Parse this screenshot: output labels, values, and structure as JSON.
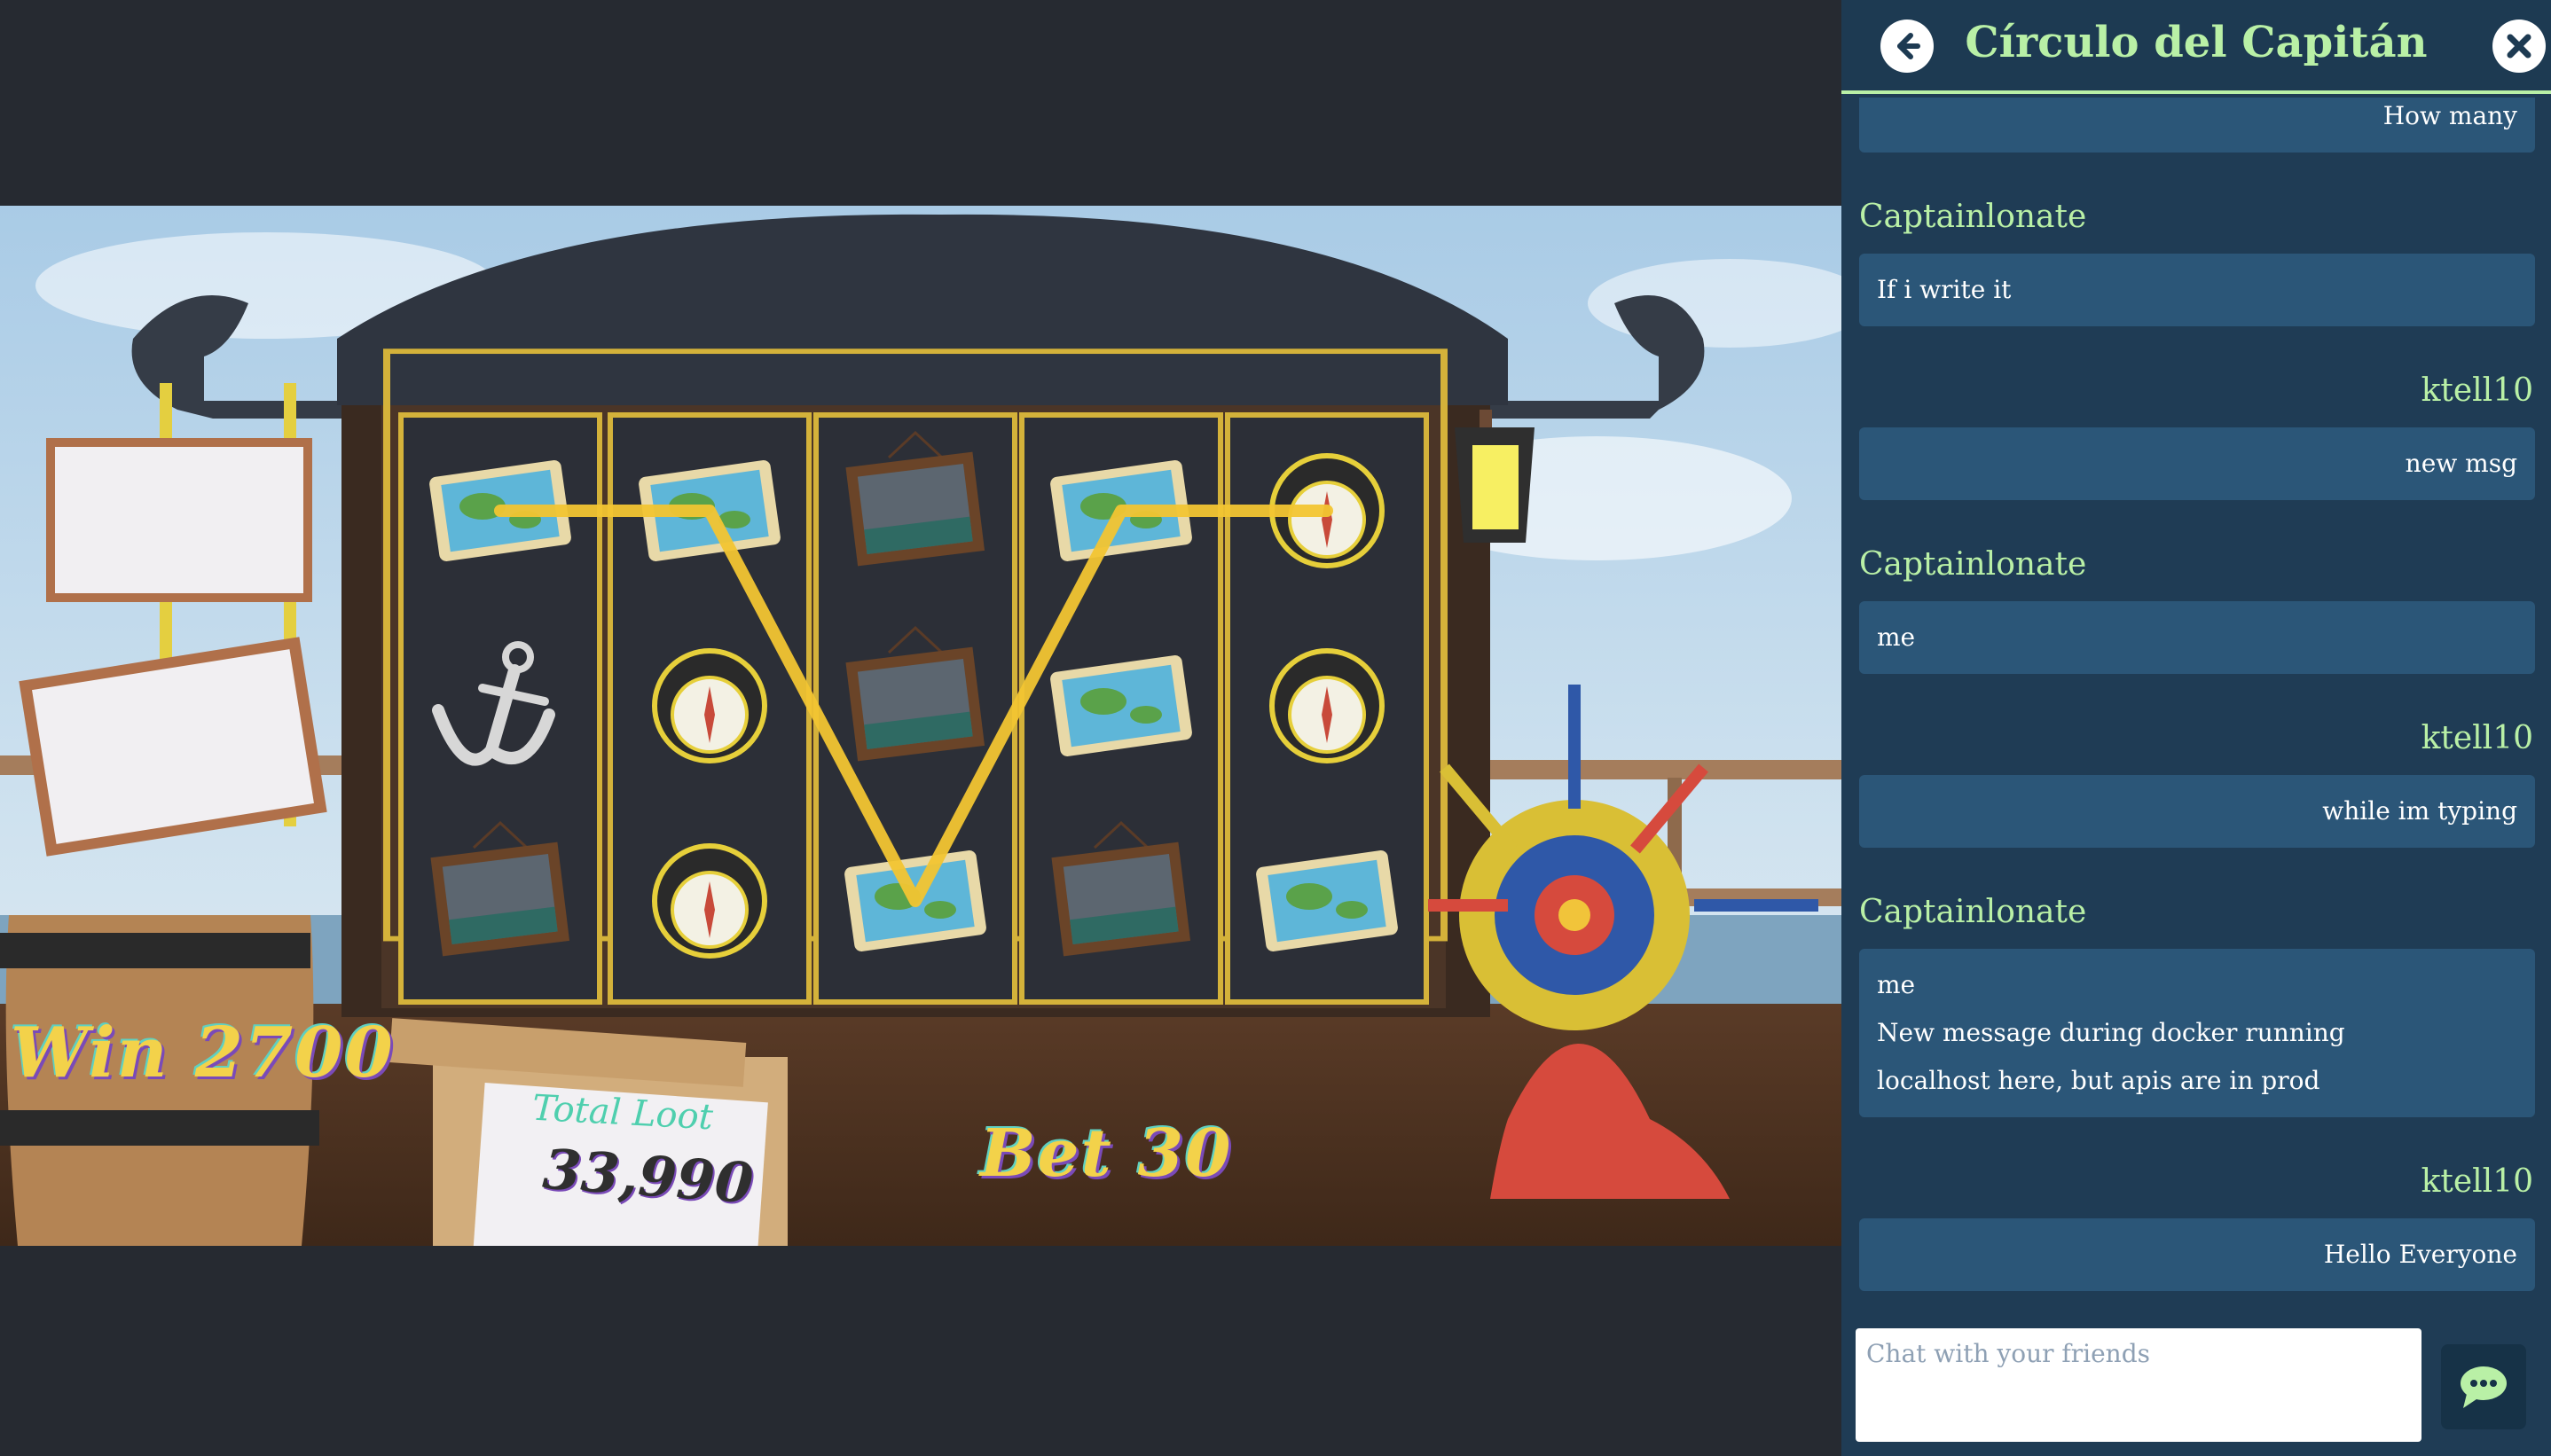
{
  "game": {
    "win_text": "Win 2700",
    "bet_text": "Bet 30",
    "total_loot_label": "Total Loot",
    "total_loot_value": "33,990",
    "reels": [
      [
        "map-icon",
        "anchor-icon",
        "painting-icon"
      ],
      [
        "map-icon",
        "compass-icon",
        "compass-icon"
      ],
      [
        "painting-icon",
        "painting-icon",
        "map-icon"
      ],
      [
        "map-icon",
        "map-icon",
        "painting-icon"
      ],
      [
        "compass-icon",
        "compass-icon",
        "map-icon"
      ]
    ],
    "colors": {
      "win_line": "#f2c531",
      "reel_frame": "#d4b23a",
      "reel_bg": "#2c2f37"
    }
  },
  "chat": {
    "title": "Círculo del Capitán",
    "back_icon": "arrow-left-icon",
    "close_icon": "close-icon",
    "send_icon": "chat-bubble-icon",
    "input_placeholder": "Chat with your friends",
    "messages": [
      {
        "side": "right",
        "sender": "",
        "lines": [
          "How many"
        ]
      },
      {
        "side": "left",
        "sender": "Captainlonate",
        "lines": [
          "If i write it"
        ]
      },
      {
        "side": "right",
        "sender": "ktell10",
        "lines": [
          "new msg"
        ]
      },
      {
        "side": "left",
        "sender": "Captainlonate",
        "lines": [
          "me"
        ]
      },
      {
        "side": "right",
        "sender": "ktell10",
        "lines": [
          "while im typing"
        ]
      },
      {
        "side": "left",
        "sender": "Captainlonate",
        "lines": [
          "me",
          "New message during docker running",
          "localhost here, but apis are in prod"
        ]
      },
      {
        "side": "right",
        "sender": "ktell10",
        "lines": [
          "Hello Everyone"
        ]
      }
    ],
    "colors": {
      "accent": "#b9f0a6",
      "panel": "#1f3c55",
      "bubble": "#2b5678"
    }
  }
}
